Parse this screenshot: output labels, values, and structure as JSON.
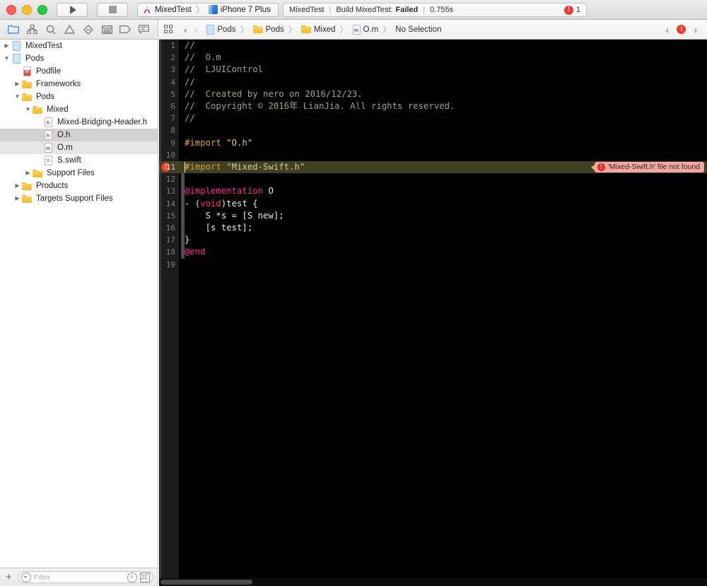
{
  "window": {
    "traffic_lights": [
      "close",
      "minimize",
      "maximize"
    ]
  },
  "toolbar": {
    "run_label": "Run",
    "stop_label": "Stop",
    "scheme": {
      "target": "MixedTest",
      "separator": "〉",
      "destination": "iPhone 7 Plus"
    }
  },
  "status": {
    "project": "MixedTest",
    "sep": "|",
    "activity": "Build MixedTest:",
    "result": "Failed",
    "duration": "0.755s",
    "issue_count": "1",
    "issue_glyph": "!"
  },
  "navigator_toolbar": {
    "icons": [
      {
        "name": "project-navigator-icon",
        "glyph": "folder",
        "active": true
      },
      {
        "name": "source-control-navigator-icon",
        "glyph": "branch",
        "active": false
      },
      {
        "name": "find-navigator-icon",
        "glyph": "search",
        "active": false
      },
      {
        "name": "issue-navigator-icon",
        "glyph": "warning",
        "active": false
      },
      {
        "name": "test-navigator-icon",
        "glyph": "diamond",
        "active": false
      },
      {
        "name": "debug-navigator-icon",
        "glyph": "gauge",
        "active": false
      },
      {
        "name": "breakpoint-navigator-icon",
        "glyph": "tag",
        "active": false
      },
      {
        "name": "report-navigator-icon",
        "glyph": "message",
        "active": false
      }
    ]
  },
  "jumpbar": {
    "grid_icon": "related-items-icon",
    "back_arrow": "‹",
    "forward_arrow": "›",
    "crumbs": [
      {
        "label": "Pods",
        "icon": "project-icon",
        "badge": "",
        "kind": "proj"
      },
      {
        "label": "Pods",
        "icon": "folder-icon",
        "badge": "",
        "kind": "folder"
      },
      {
        "label": "Mixed",
        "icon": "folder-icon",
        "badge": "",
        "kind": "folder"
      },
      {
        "label": "O.m",
        "icon": "objc-file-icon",
        "badge": "m",
        "kind": "m"
      },
      {
        "label": "No Selection",
        "icon": "",
        "badge": "",
        "kind": "none"
      }
    ],
    "separator": "〉",
    "right": {
      "prev_issue": "‹",
      "issue_glyph": "!",
      "next_issue": "›"
    }
  },
  "navigator": {
    "rows": [
      {
        "label": "MixedTest",
        "indent": 0,
        "disclosure": "collapsed",
        "kind": "proj",
        "badge": "",
        "selected": ""
      },
      {
        "label": "Pods",
        "indent": 0,
        "disclosure": "expanded",
        "kind": "proj",
        "badge": "",
        "selected": ""
      },
      {
        "label": "Podfile",
        "indent": 1,
        "disclosure": "none",
        "kind": "rb",
        "badge": "rb",
        "selected": ""
      },
      {
        "label": "Frameworks",
        "indent": 1,
        "disclosure": "collapsed",
        "kind": "folder",
        "badge": "",
        "selected": ""
      },
      {
        "label": "Pods",
        "indent": 1,
        "disclosure": "expanded",
        "kind": "folder",
        "badge": "",
        "selected": ""
      },
      {
        "label": "Mixed",
        "indent": 2,
        "disclosure": "expanded",
        "kind": "folder",
        "badge": "",
        "selected": ""
      },
      {
        "label": "Mixed-Bridging-Header.h",
        "indent": 3,
        "disclosure": "none",
        "kind": "h",
        "badge": "h",
        "selected": ""
      },
      {
        "label": "O.h",
        "indent": 3,
        "disclosure": "none",
        "kind": "h",
        "badge": "h",
        "selected": "dark"
      },
      {
        "label": "O.m",
        "indent": 3,
        "disclosure": "none",
        "kind": "m",
        "badge": "m",
        "selected": "light"
      },
      {
        "label": "S.swift",
        "indent": 3,
        "disclosure": "none",
        "kind": "swift",
        "badge": "S",
        "selected": ""
      },
      {
        "label": "Support Files",
        "indent": 2,
        "disclosure": "collapsed",
        "kind": "folder",
        "badge": "",
        "selected": ""
      },
      {
        "label": "Products",
        "indent": 1,
        "disclosure": "collapsed",
        "kind": "folder",
        "badge": "",
        "selected": ""
      },
      {
        "label": "Targets Support Files",
        "indent": 1,
        "disclosure": "collapsed",
        "kind": "folder",
        "badge": "",
        "selected": ""
      }
    ]
  },
  "filterbar": {
    "add_label": "+",
    "placeholder": "Filter",
    "recent_icon": "clock-icon",
    "source-control_icon": "filter-scm-icon"
  },
  "editor": {
    "first_line": 1,
    "lines": [
      {
        "n": 1,
        "tokens": [
          {
            "t": "//",
            "c": "comment"
          }
        ]
      },
      {
        "n": 2,
        "tokens": [
          {
            "t": "//  O.m",
            "c": "comment"
          }
        ]
      },
      {
        "n": 3,
        "tokens": [
          {
            "t": "//  LJUIControl",
            "c": "comment"
          }
        ]
      },
      {
        "n": 4,
        "tokens": [
          {
            "t": "//",
            "c": "comment"
          }
        ]
      },
      {
        "n": 5,
        "tokens": [
          {
            "t": "//  Created by nero on 2016/12/23.",
            "c": "comment"
          }
        ]
      },
      {
        "n": 6,
        "tokens": [
          {
            "t": "//  Copyright © 2016年 LianJia. All rights reserved.",
            "c": "comment"
          }
        ]
      },
      {
        "n": 7,
        "tokens": [
          {
            "t": "//",
            "c": "comment"
          }
        ]
      },
      {
        "n": 8,
        "tokens": []
      },
      {
        "n": 9,
        "tokens": [
          {
            "t": "#import ",
            "c": "pre"
          },
          {
            "t": "\"O.h\"",
            "c": "str"
          }
        ]
      },
      {
        "n": 10,
        "tokens": []
      },
      {
        "n": 11,
        "tokens": [
          {
            "t": "#import ",
            "c": "pre"
          },
          {
            "t": "\"Mixed-Swift.h\"",
            "c": "str"
          }
        ],
        "error": true
      },
      {
        "n": 12,
        "tokens": [],
        "changed": true
      },
      {
        "n": 13,
        "tokens": [
          {
            "t": "@implementation",
            "c": "kw"
          },
          {
            "t": " O",
            "c": "plain"
          }
        ],
        "changed": true
      },
      {
        "n": 14,
        "tokens": [
          {
            "t": "- (",
            "c": "plain"
          },
          {
            "t": "void",
            "c": "kw"
          },
          {
            "t": ")test {",
            "c": "plain"
          }
        ],
        "changed": true
      },
      {
        "n": 15,
        "tokens": [
          {
            "t": "    S *s = [S new];",
            "c": "plain"
          }
        ],
        "changed": true
      },
      {
        "n": 16,
        "tokens": [
          {
            "t": "    [s test];",
            "c": "plain"
          }
        ],
        "changed": true
      },
      {
        "n": 17,
        "tokens": [
          {
            "t": "}",
            "c": "plain"
          }
        ],
        "changed": true
      },
      {
        "n": 18,
        "tokens": [
          {
            "t": "@end",
            "c": "kw"
          }
        ],
        "changed": true
      },
      {
        "n": 19,
        "tokens": []
      }
    ],
    "error": {
      "line": 11,
      "message": "'Mixed-Swift.h' file not found",
      "glyph": "!"
    }
  }
}
